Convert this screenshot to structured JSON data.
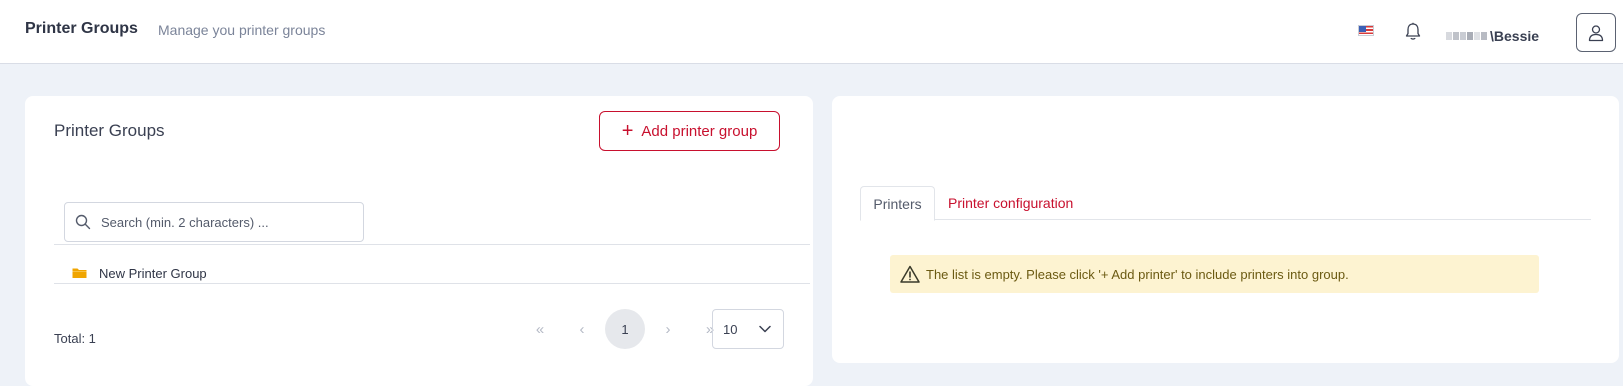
{
  "header": {
    "title": "Printer Groups",
    "subtitle": "Manage you printer groups",
    "language_flag": "us-flag-icon",
    "notification_icon": "bell-icon",
    "username": "\\Bessie",
    "user_icon": "user-icon"
  },
  "left_card": {
    "title": "Printer Groups",
    "add_button_label": "Add printer group",
    "search_placeholder": "Search (min. 2 characters) ...",
    "groups": [
      {
        "name": "New Printer Group",
        "icon": "folder-icon"
      }
    ],
    "total_label": "Total: 1",
    "pagination": {
      "first": "«",
      "prev": "‹",
      "current": "1",
      "next": "›",
      "last": "»"
    },
    "page_size": "10"
  },
  "right_card": {
    "tabs": [
      {
        "label": "Printers",
        "active": true
      },
      {
        "label": "Printer configuration",
        "active": false
      }
    ],
    "alert_message": "The list is empty. Please click '+ Add printer' to include printers into group."
  },
  "colors": {
    "accent": "#c8102e",
    "background": "#eef2f8",
    "alert_bg": "#fdf3d1",
    "folder": "#f0a500"
  }
}
